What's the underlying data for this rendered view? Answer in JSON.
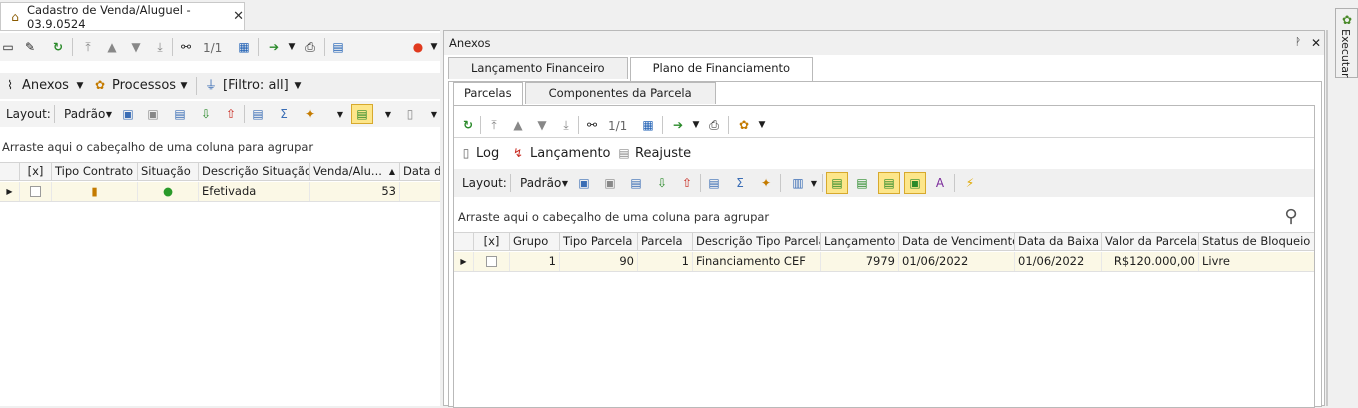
{
  "doc_tab": {
    "title": "Cadastro de Venda/Aluguel - 03.9.0524",
    "close": "✕"
  },
  "left": {
    "toolbar": {
      "counter": "1/1"
    },
    "menu": {
      "anexos": "Anexos",
      "processos": "Processos",
      "filtro": "[Filtro: all]"
    },
    "layout": {
      "label": "Layout:",
      "preset": "Padrão"
    },
    "group_hint": "Arraste aqui o cabeçalho de uma coluna para agrupar",
    "grid": {
      "headers": [
        "[x]",
        "Tipo Contrato",
        "Situação",
        "Descrição Situação",
        "Venda/Alu...",
        "Data de"
      ],
      "row": {
        "descricao": "Efetivada",
        "venda": "53"
      }
    }
  },
  "right": {
    "title": "Anexos",
    "pin": "ᚹ",
    "close": "✕",
    "tabs": [
      "Lançamento Financeiro",
      "Plano de Financiamento"
    ],
    "subtabs": [
      "Parcelas",
      "Componentes da Parcela"
    ],
    "toolbar": {
      "counter": "1/1"
    },
    "menu": {
      "log": "Log",
      "lancamento": "Lançamento",
      "reajuste": "Reajuste"
    },
    "layout": {
      "label": "Layout:",
      "preset": "Padrão"
    },
    "group_hint": "Arraste aqui o cabeçalho de uma coluna para agrupar",
    "grid": {
      "headers": [
        "[x]",
        "Grupo",
        "Tipo Parcela",
        "Parcela",
        "Descrição Tipo Parcela",
        "Lançamento",
        "Data de Vencimento",
        "Data da Baixa",
        "Valor da Parcela",
        "Status de Bloqueio do"
      ],
      "row": {
        "grupo": "1",
        "tipo": "90",
        "parcela": "1",
        "descricao": "Financiamento CEF",
        "lancamento": "7979",
        "vencimento": "01/06/2022",
        "baixa": "01/06/2022",
        "valor": "R$120.000,00",
        "status": "Livre"
      }
    }
  },
  "sidebar": {
    "label": "Executar"
  }
}
